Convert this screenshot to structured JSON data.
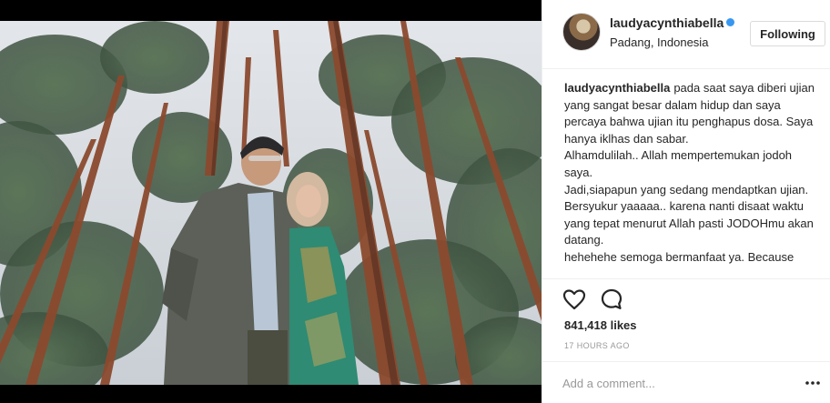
{
  "photo": {
    "description_icon": "photo-image",
    "sky_color": "#d8dde3",
    "trunk_color": "#8b4a2e",
    "foliage_color": "#3f5a3c"
  },
  "header": {
    "username": "laudyacynthiabella",
    "verified_icon": "verified-badge-icon",
    "location": "Padang, Indonesia",
    "follow_label": "Following"
  },
  "caption": {
    "author": "laudyacynthiabella",
    "lines": [
      "pada saat saya diberi ujian yang sangat besar dalam hidup dan saya percaya bahwa ujian itu penghapus dosa. Saya hanya iklhas dan sabar.",
      "Alhamdulilah.. Allah mempertemukan jodoh saya.",
      "Jadi,siapapun yang sedang mendaptkan ujian.",
      "Bersyukur yaaaaa.. karena nanti disaat waktu yang tepat menurut Allah pasti JODOHmu akan datang.",
      "hehehehe semoga bermanfaat ya. Because"
    ]
  },
  "actions": {
    "like_icon": "heart-icon",
    "comment_icon": "comment-bubble-icon",
    "likes": "841,418 likes",
    "timestamp": "17 HOURS AGO"
  },
  "comment": {
    "placeholder": "Add a comment...",
    "more_icon": "more-options-icon"
  }
}
